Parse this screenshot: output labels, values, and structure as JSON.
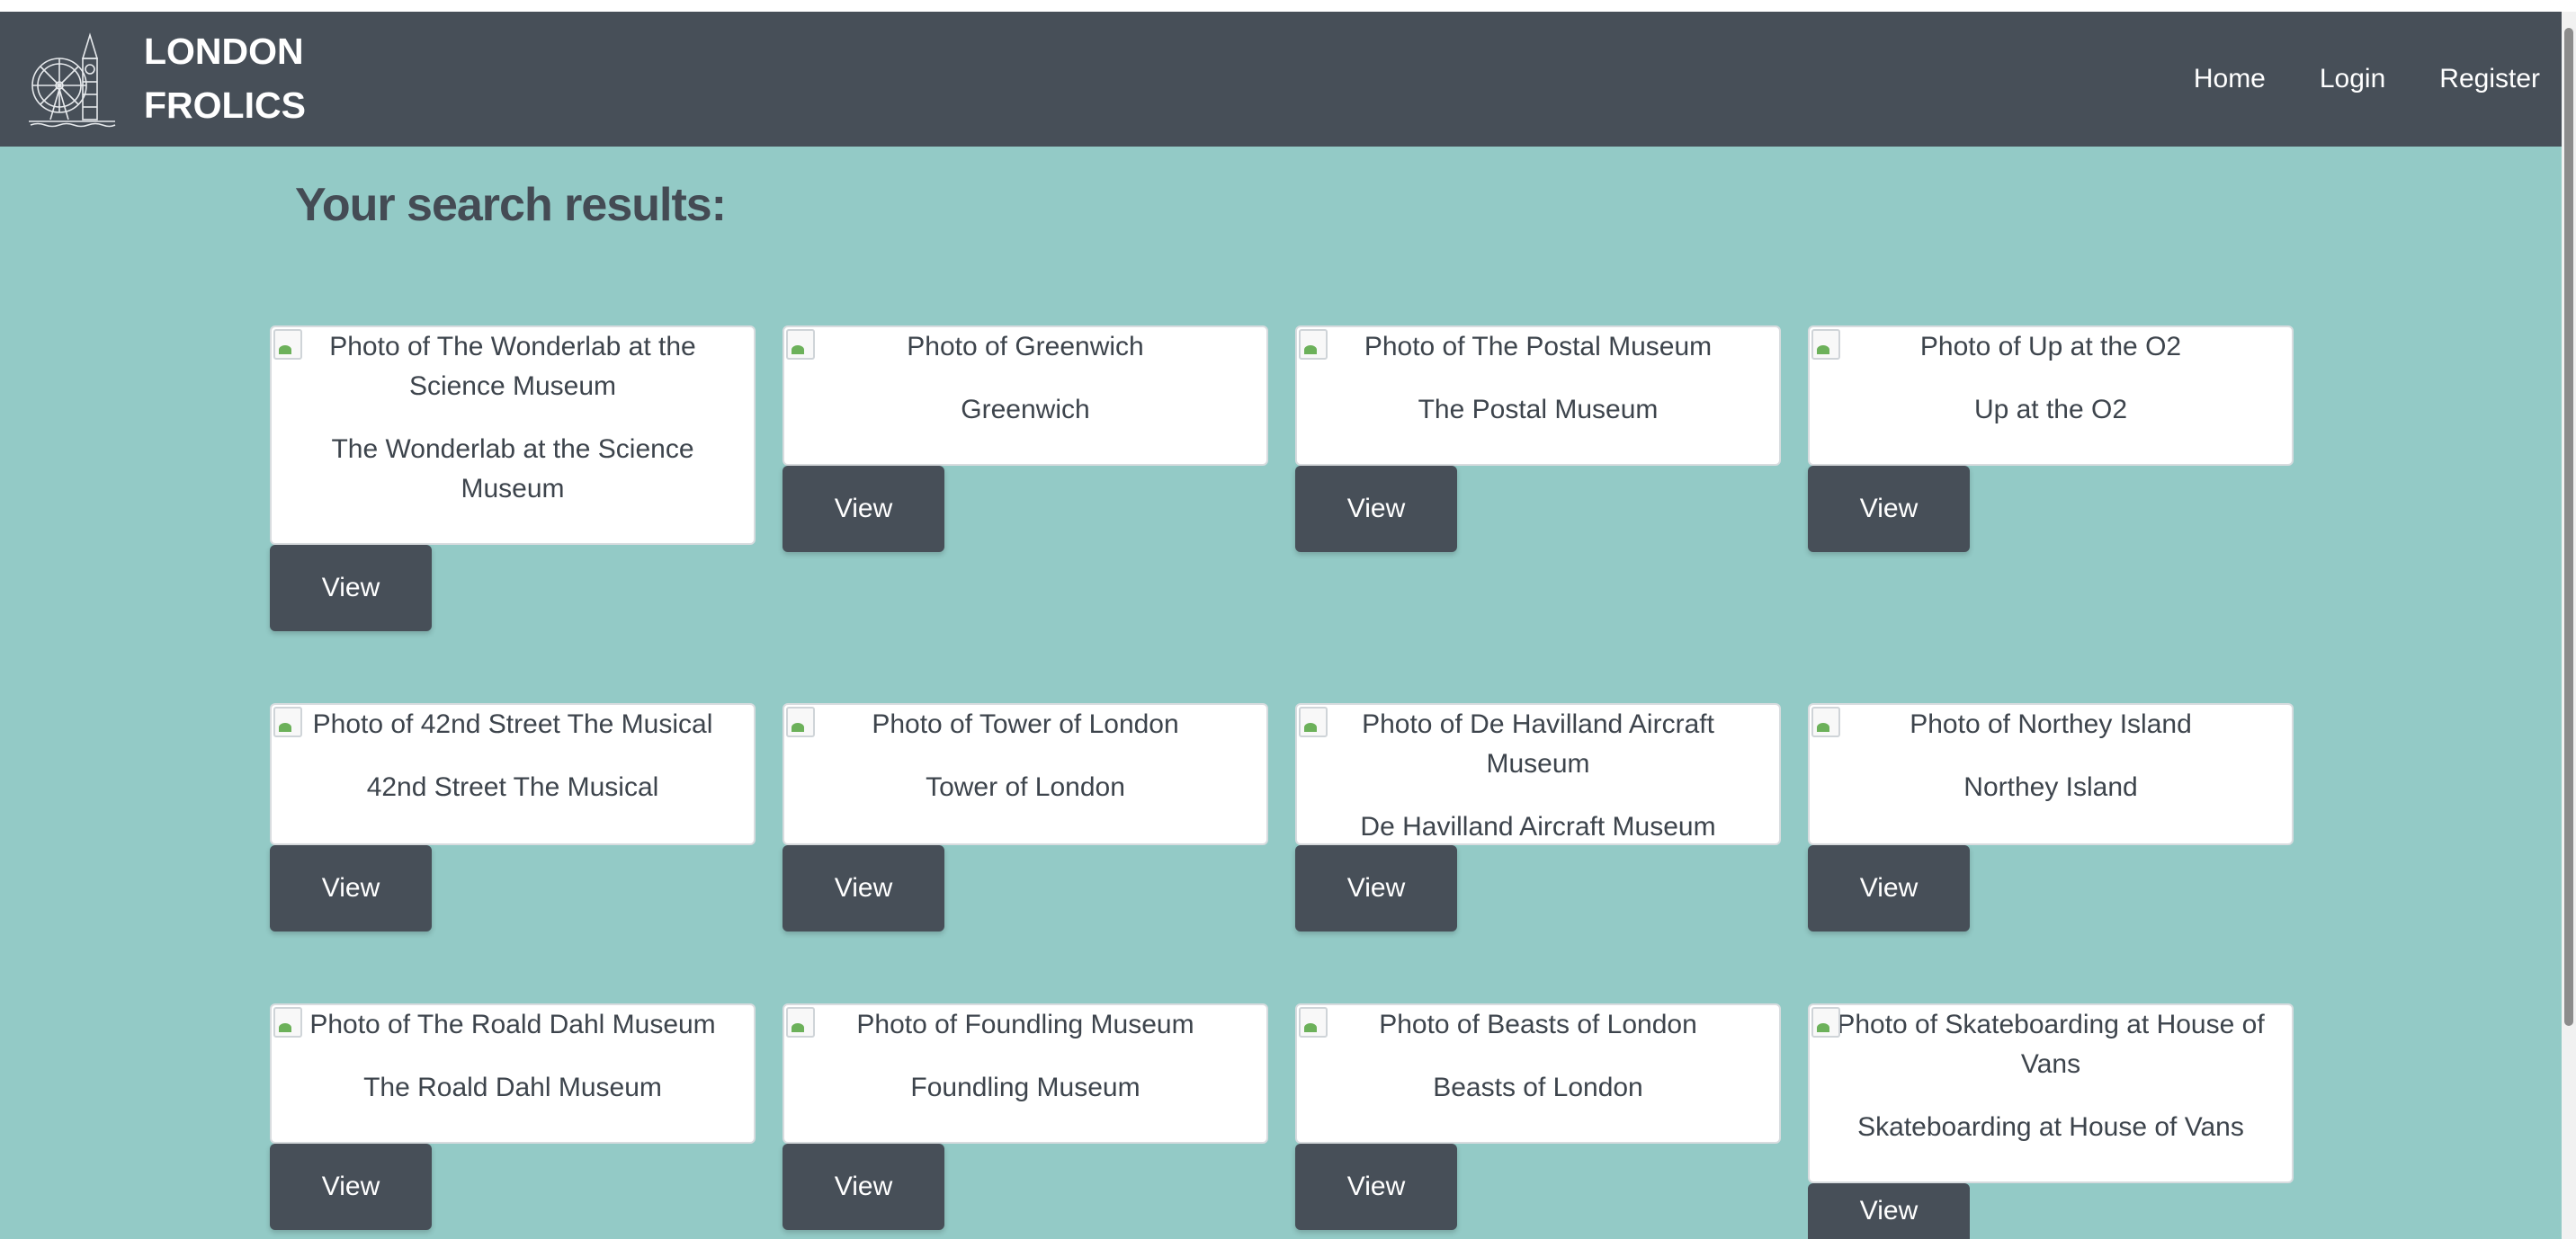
{
  "brand": {
    "line1": "LONDON",
    "line2": "FROLICS"
  },
  "nav": {
    "home": "Home",
    "login": "Login",
    "register": "Register"
  },
  "page_title": "Your search results:",
  "colors": {
    "navbar": "#474f58",
    "background": "#93cac6",
    "button": "#474f58"
  },
  "results": [
    {
      "alt": "Photo of The Wonderlab at the Science Museum",
      "name": "The Wonderlab at the Science Museum",
      "button": "View"
    },
    {
      "alt": "Photo of Greenwich",
      "name": "Greenwich",
      "button": "View"
    },
    {
      "alt": "Photo of The Postal Museum",
      "name": "The Postal Museum",
      "button": "View"
    },
    {
      "alt": "Photo of Up at the O2",
      "name": "Up at the O2",
      "button": "View"
    },
    {
      "alt": "Photo of 42nd Street The Musical",
      "name": "42nd Street The Musical",
      "button": "View"
    },
    {
      "alt": "Photo of Tower of London",
      "name": "Tower of London",
      "button": "View"
    },
    {
      "alt": "Photo of De Havilland Aircraft Museum",
      "name": "De Havilland Aircraft Museum",
      "button": "View"
    },
    {
      "alt": "Photo of Northey Island",
      "name": "Northey Island",
      "button": "View"
    },
    {
      "alt": "Photo of The Roald Dahl Museum",
      "name": "The Roald Dahl Museum",
      "button": "View"
    },
    {
      "alt": "Photo of Foundling Museum",
      "name": "Foundling Museum",
      "button": "View"
    },
    {
      "alt": "Photo of Beasts of London",
      "name": "Beasts of London",
      "button": "View"
    },
    {
      "alt": "Photo of Skateboarding at House of Vans",
      "name": "Skateboarding at House of Vans",
      "button": "View"
    }
  ]
}
